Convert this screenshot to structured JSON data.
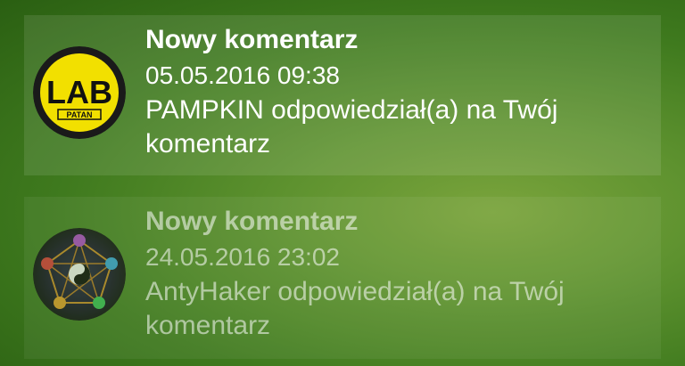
{
  "notifications": [
    {
      "title": "Nowy komentarz",
      "time": "05.05.2016 09:38",
      "message": "PAMPKIN odpowiedział(a) na Twój komentarz",
      "avatar_text": "LAB",
      "avatar_subtext": "PATAN",
      "avatar_icon": "lab-patan-logo-icon"
    },
    {
      "title": "Nowy komentarz",
      "time": "24.05.2016 23:02",
      "message": "AntyHaker odpowiedział(a) na Twój komentarz",
      "avatar_icon": "yin-yang-pentagram-icon"
    }
  ]
}
